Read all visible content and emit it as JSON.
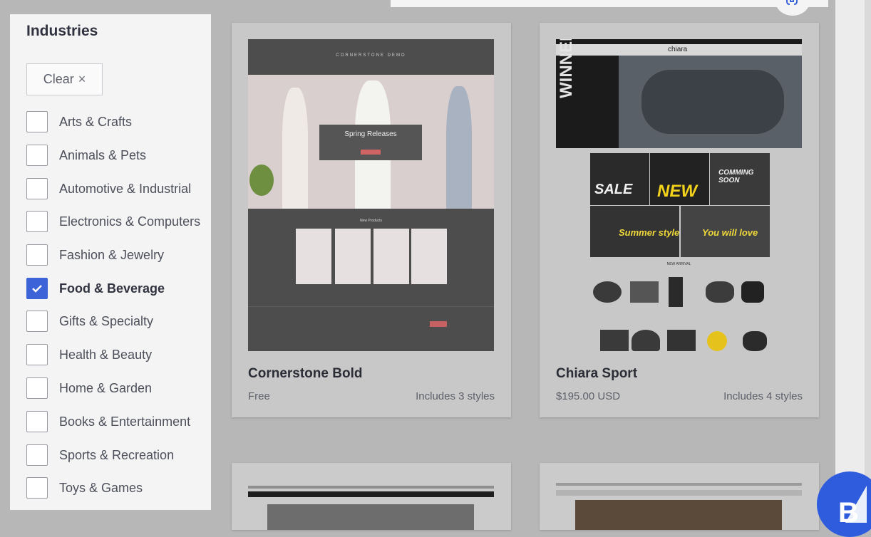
{
  "sidebar": {
    "heading": "Industries",
    "clear_label": "Clear",
    "clear_icon": "×",
    "options": [
      {
        "label": "Arts & Crafts",
        "checked": false
      },
      {
        "label": "Animals & Pets",
        "checked": false
      },
      {
        "label": "Automotive & Industrial",
        "checked": false
      },
      {
        "label": "Electronics & Computers",
        "checked": false
      },
      {
        "label": "Fashion & Jewelry",
        "checked": false
      },
      {
        "label": "Food & Beverage",
        "checked": true
      },
      {
        "label": "Gifts & Specialty",
        "checked": false
      },
      {
        "label": "Health & Beauty",
        "checked": false
      },
      {
        "label": "Home & Garden",
        "checked": false
      },
      {
        "label": "Books & Entertainment",
        "checked": false
      },
      {
        "label": "Sports & Recreation",
        "checked": false
      },
      {
        "label": "Toys & Games",
        "checked": false
      }
    ]
  },
  "themes": [
    {
      "name": "Cornerstone Bold",
      "price": "Free",
      "styles": "Includes 3 styles",
      "preview": {
        "header": "CORNERSTONE DEMO",
        "banner_title": "Spring Releases",
        "section_title": "New Products"
      }
    },
    {
      "name": "Chiara Sport",
      "price": "$195.00 USD",
      "styles": "Includes 4 styles",
      "preview": {
        "logo": "chiara",
        "hero_text": "WINNERS MINDSET",
        "tiles": [
          "SALE",
          "NEW",
          "COMMING SOON",
          "Summer style",
          "You will love"
        ],
        "section_title": "NEW ARRIVAL"
      }
    }
  ],
  "colors": {
    "accent": "#3c64d8",
    "badge": "#2f5cdc"
  },
  "icons": {
    "check": "check-icon",
    "badge": "bigcommerce-logo-icon"
  }
}
